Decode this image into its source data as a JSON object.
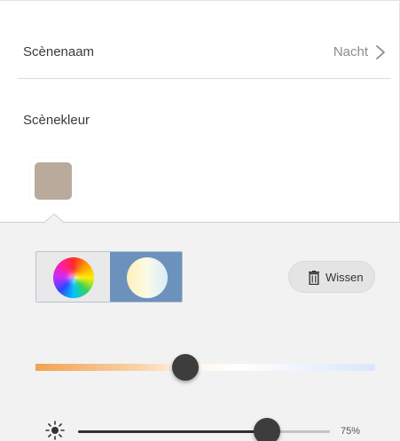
{
  "scene": {
    "name_label": "Scènenaam",
    "name_value": "Nacht",
    "color_label": "Scènekleur",
    "swatch_color": "#b9aa9b"
  },
  "panel": {
    "modes": [
      {
        "id": "color-wheel",
        "icon": "color-wheel-icon",
        "selected": false
      },
      {
        "id": "white-temperature",
        "icon": "temperature-circle-icon",
        "selected": true
      }
    ],
    "clear_label": "Wissen",
    "temperature_position": 0.44,
    "brightness_percent": 75,
    "brightness_label": "75%"
  }
}
